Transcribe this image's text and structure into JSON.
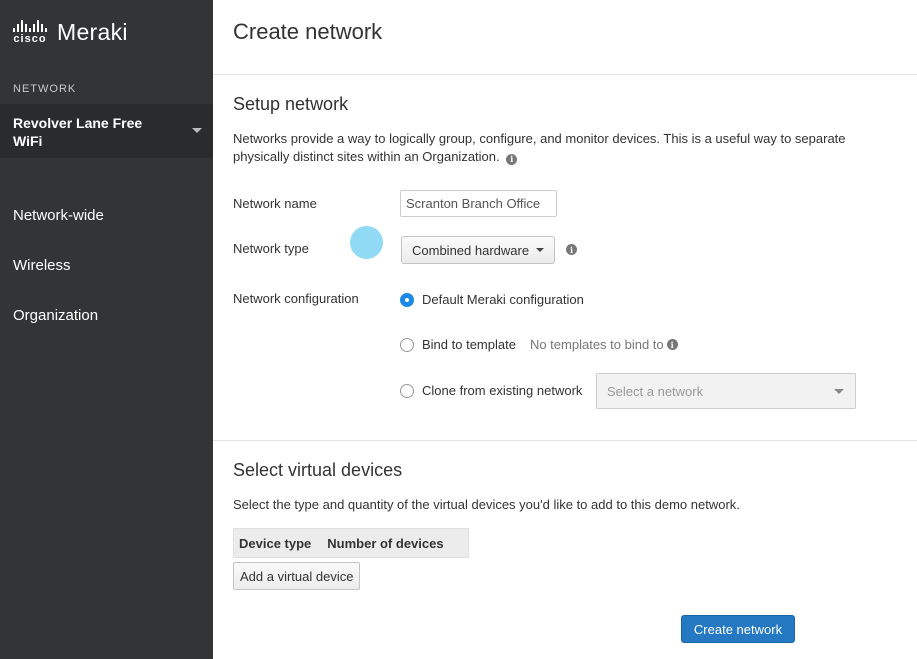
{
  "sidebar": {
    "brand": {
      "cisco": "cisco",
      "product": "Meraki"
    },
    "section_label": "NETWORK",
    "network_selector": {
      "label": "Revolver Lane Free WiFi"
    },
    "items": [
      {
        "label": "Network-wide"
      },
      {
        "label": "Wireless"
      },
      {
        "label": "Organization"
      }
    ]
  },
  "main": {
    "title": "Create network",
    "setup": {
      "title": "Setup network",
      "description": "Networks provide a way to logically group, configure, and monitor devices. This is a useful way to separate physically distinct sites within an Organization.",
      "network_name_label": "Network name",
      "network_name_value": "Scranton Branch Office",
      "network_type_label": "Network type",
      "network_type_value": "Combined hardware",
      "network_config_label": "Network configuration",
      "options": {
        "default": "Default Meraki configuration",
        "bind": "Bind to template",
        "bind_note": "No templates to bind to",
        "clone": "Clone from existing network",
        "clone_placeholder": "Select a network"
      },
      "selected_option": "default"
    },
    "virtual": {
      "title": "Select virtual devices",
      "description": "Select the type and quantity of the virtual devices you'd like to add to this demo network.",
      "columns": [
        "Device type",
        "Number of devices"
      ],
      "add_button": "Add a virtual device"
    },
    "create_button": "Create network"
  },
  "colors": {
    "sidebar_bg": "#333435",
    "primary_button": "#2479c2",
    "radio_selected": "#1a8ae6"
  },
  "icons": {
    "info": "info-icon",
    "caret": "chevron-down-icon"
  }
}
